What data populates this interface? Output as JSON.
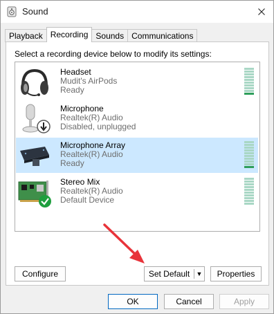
{
  "window": {
    "title": "Sound"
  },
  "tabs": [
    {
      "label": "Playback",
      "active": false
    },
    {
      "label": "Recording",
      "active": true
    },
    {
      "label": "Sounds",
      "active": false
    },
    {
      "label": "Communications",
      "active": false
    }
  ],
  "panel": {
    "instruction": "Select a recording device below to modify its settings:"
  },
  "devices": [
    {
      "name": "Headset",
      "line1": "Mudit's AirPods",
      "line2": "Ready",
      "icon": "headset-icon",
      "selected": false,
      "level": 0.1
    },
    {
      "name": "Microphone",
      "line1": "Realtek(R) Audio",
      "line2": "Disabled, unplugged",
      "icon": "microphone-icon",
      "selected": false,
      "level": null
    },
    {
      "name": "Microphone Array",
      "line1": "Realtek(R) Audio",
      "line2": "Ready",
      "icon": "microphone-array-icon",
      "selected": true,
      "level": 0.1
    },
    {
      "name": "Stereo Mix",
      "line1": "Realtek(R) Audio",
      "line2": "Default Device",
      "icon": "sound-card-icon",
      "selected": false,
      "level": 0
    }
  ],
  "buttons": {
    "configure": "Configure",
    "set_default": "Set Default",
    "properties": "Properties",
    "ok": "OK",
    "cancel": "Cancel",
    "apply": "Apply"
  },
  "colors": {
    "selected_row": "#cce8ff",
    "meter_idle": "#a9d7c5",
    "meter_active": "#2e9e5b",
    "annotation_arrow": "#e8333a",
    "default_check": "#1e9e3e"
  }
}
